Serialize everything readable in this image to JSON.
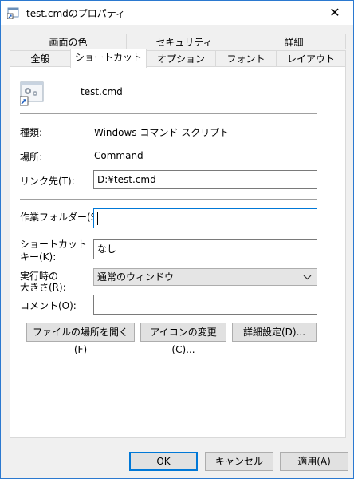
{
  "window": {
    "title": "test.cmdのプロパティ",
    "close": "✕"
  },
  "tabs_back": [
    "画面の色",
    "セキュリティ",
    "詳細"
  ],
  "tabs_front": [
    "全般",
    "ショートカット",
    "オプション",
    "フォント",
    "レイアウト"
  ],
  "active_tab": "ショートカット",
  "shortcut": {
    "name": "test.cmd",
    "type_label": "種類:",
    "type_value": "Windows コマンド スクリプト",
    "location_label": "場所:",
    "location_value": "Command",
    "target_label": "リンク先(T):",
    "target_value": "D:¥test.cmd",
    "startin_label": "作業フォルダー(S):",
    "startin_value": "",
    "hotkey_label_1": "ショートカット",
    "hotkey_label_2": "キー(K):",
    "hotkey_value": "なし",
    "run_label_1": "実行時の",
    "run_label_2": "大きさ(R):",
    "run_value": "通常のウィンドウ",
    "comment_label": "コメント(O):",
    "comment_value": ""
  },
  "actions": {
    "open_location": "ファイルの場所を開く(F)",
    "change_icon": "アイコンの変更(C)...",
    "advanced": "詳細設定(D)..."
  },
  "footer": {
    "ok": "OK",
    "cancel": "キャンセル",
    "apply": "適用(A)"
  },
  "colors": {
    "accent": "#0078d7",
    "window_border": "#2b79d0"
  }
}
